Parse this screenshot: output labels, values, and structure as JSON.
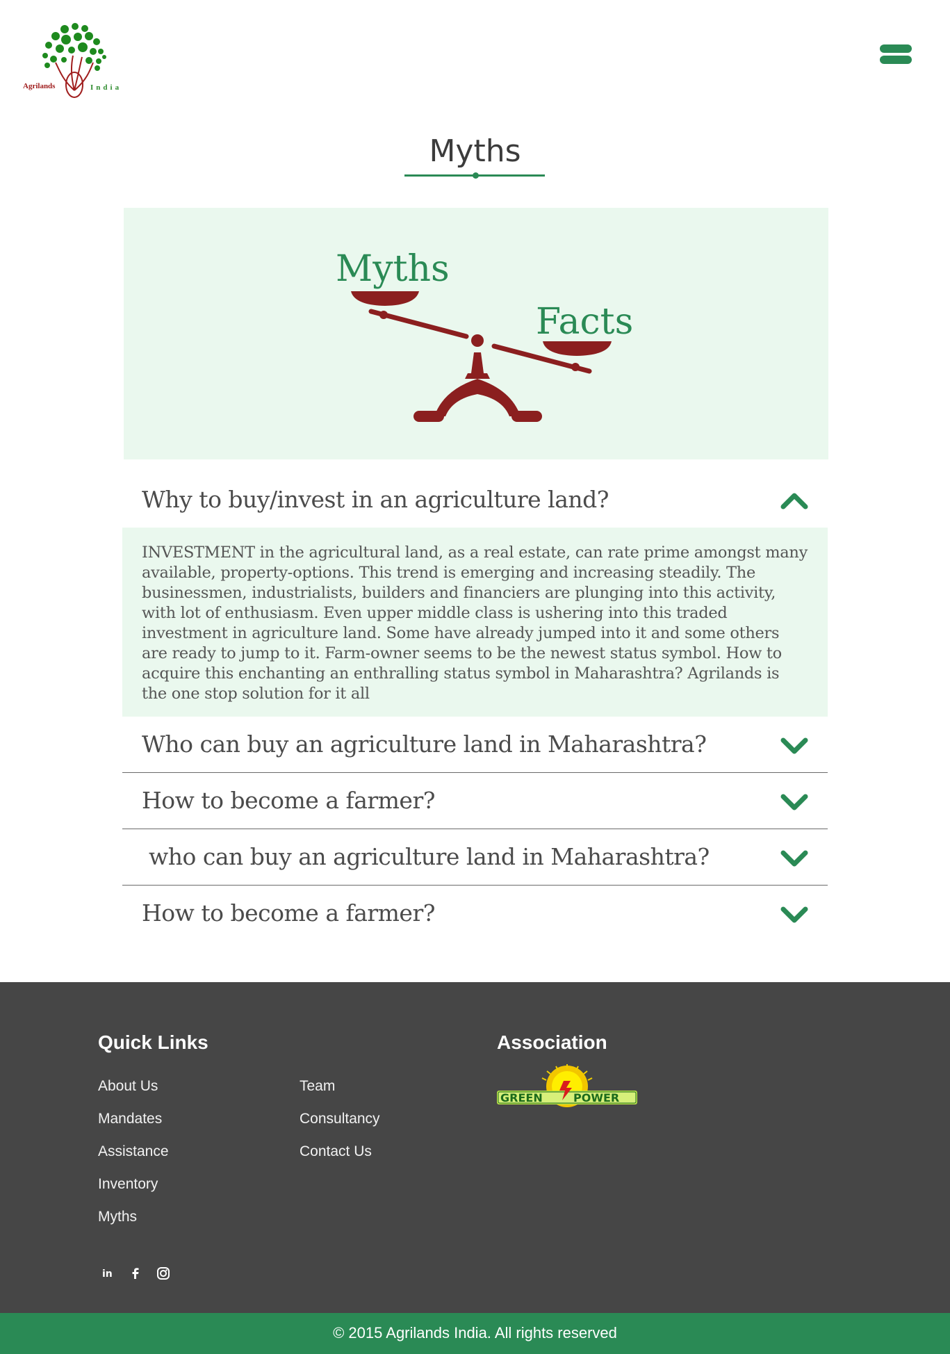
{
  "brand": {
    "name_left": "Agrilands",
    "name_right": "India"
  },
  "page": {
    "title": "Myths"
  },
  "hero": {
    "left_word": "Myths",
    "right_word": "Facts"
  },
  "faq": [
    {
      "question": "Why to buy/invest in an agriculture land?",
      "expanded": true,
      "answer": "INVESTMENT in the agricultural land, as a real estate, can rate prime amongst many available, property-options. This trend is emerging and increasing steadily. The businessmen, industrialists, builders and financiers are plunging into this activity, with lot of enthusiasm. Even upper middle class is ushering into this traded investment in agriculture land. Some have already jumped into it and some others are ready to jump to it. Farm-owner seems to be the newest status symbol. How to acquire this enchanting an enthralling status symbol in Maharashtra? Agrilands is the one stop solution for it all"
    },
    {
      "question": "Who can buy an agriculture land in Maharashtra?",
      "expanded": false
    },
    {
      "question": "How to become a farmer?",
      "expanded": false
    },
    {
      "question": " who can buy an agriculture land in Maharashtra?",
      "expanded": false
    },
    {
      "question": "How to become a farmer?",
      "expanded": false
    }
  ],
  "footer": {
    "quick_links_title": "Quick Links",
    "quick_links_col1": [
      "About Us",
      "Mandates",
      "Assistance",
      "Inventory",
      "Myths"
    ],
    "quick_links_col2": [
      "Team",
      "Consultancy",
      "Contact Us"
    ],
    "association_title": "Association",
    "association_logo_text": {
      "left": "GREEN",
      "right": "POWER"
    },
    "social": [
      "linkedin-icon",
      "facebook-icon",
      "instagram-icon"
    ],
    "copyright": "© 2015 Agrilands India. All rights reserved"
  },
  "colors": {
    "accent": "#2a8a55",
    "hero_bg": "#eaf8ee",
    "scale": "#8b1f1f",
    "footer_bg": "#464646"
  }
}
